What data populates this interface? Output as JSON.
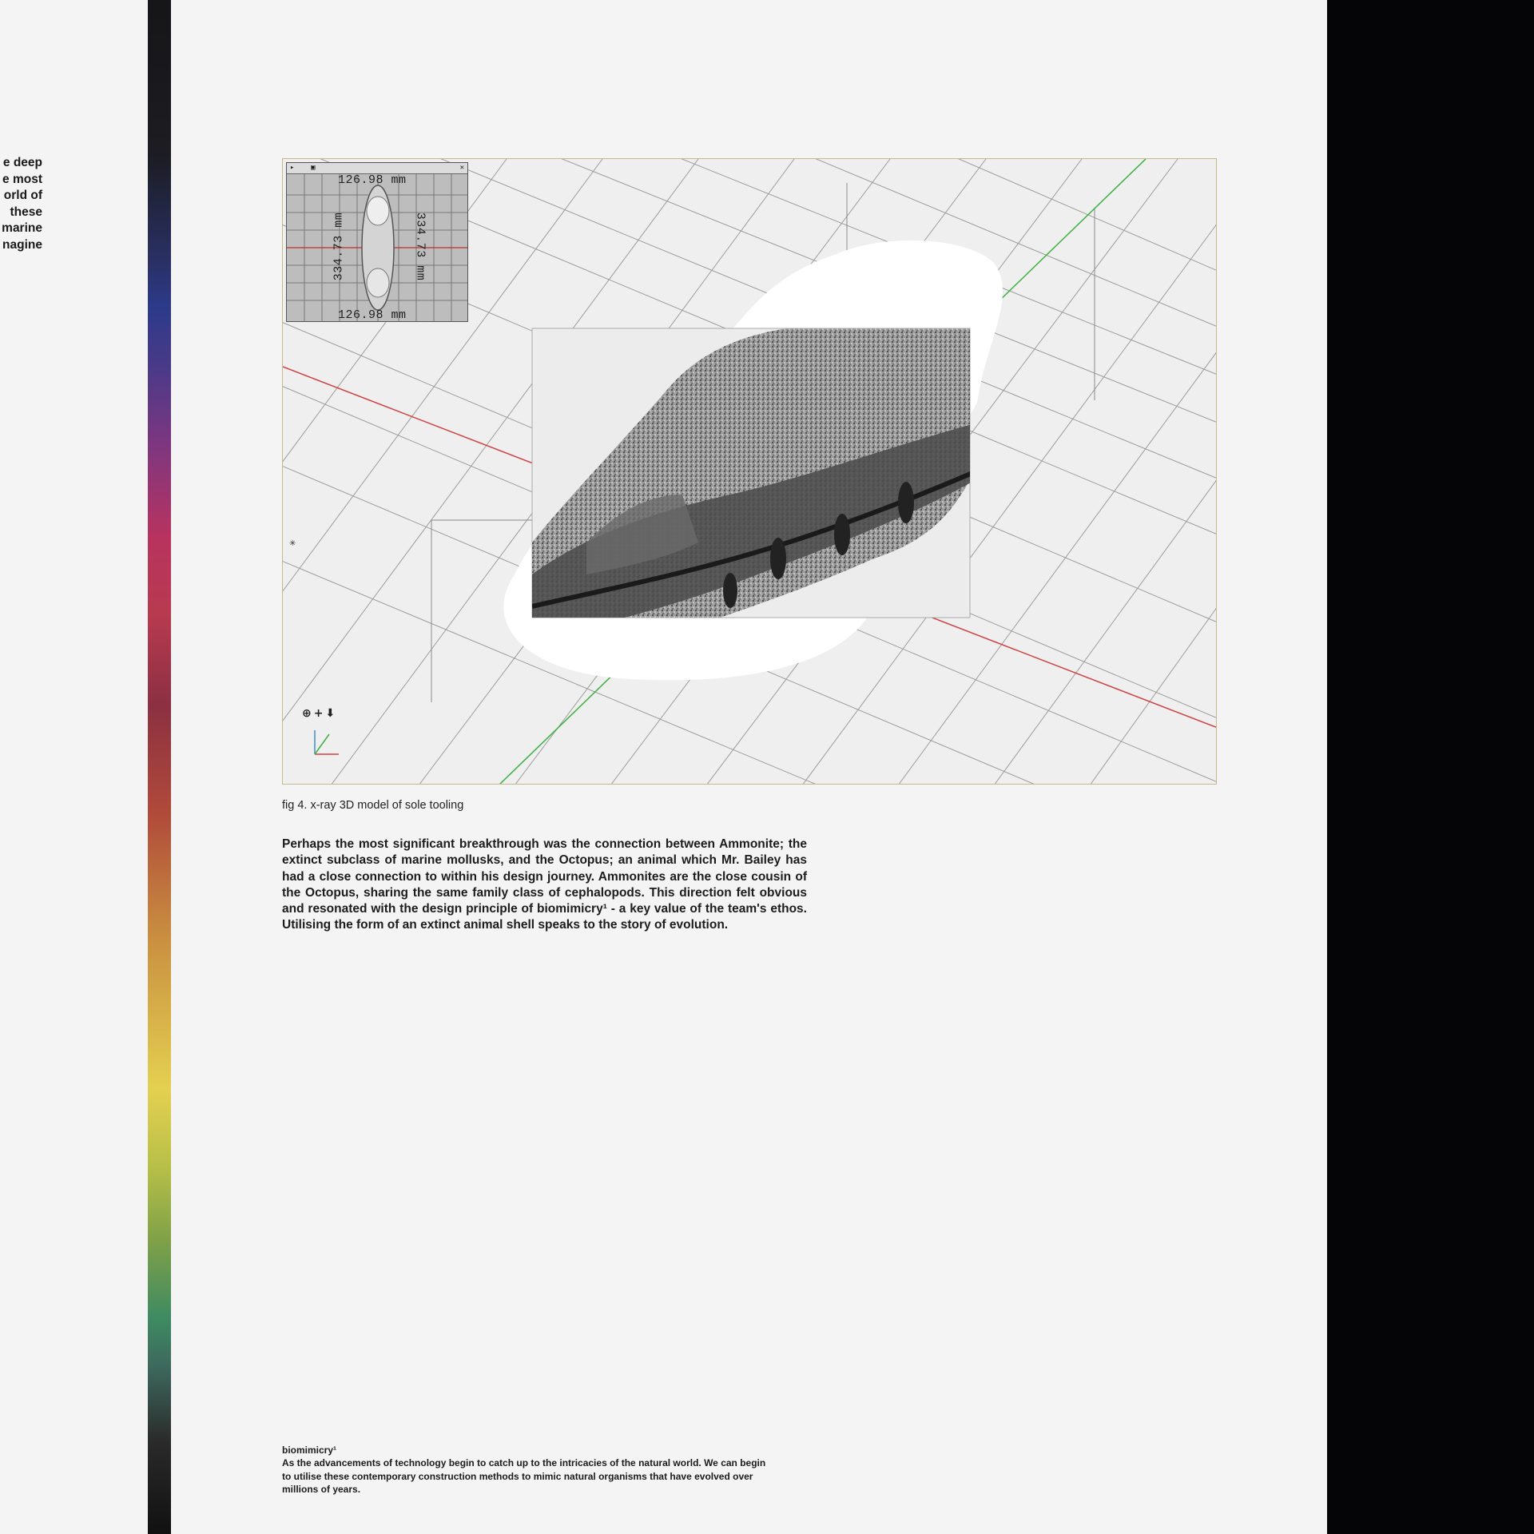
{
  "left_page": {
    "fragments": [
      "e deep",
      "e most",
      "orld of",
      "these",
      "marine",
      "nagine"
    ]
  },
  "figure": {
    "mini_view": {
      "dim_top": "126.98 mm",
      "dim_bottom": "126.98 mm",
      "dim_left": "334.73 mm",
      "dim_right": "334.73 mm"
    },
    "axis_controls": "⊕+⬇"
  },
  "caption": "fig 4. x-ray 3D model of sole tooling",
  "body": {
    "paragraph": "Perhaps the most significant breakthrough was the connection between Ammonite; the extinct subclass of marine mollusks, and the Octopus; an animal which Mr. Bailey has had a close connection to within his design journey. Ammonites are the close cousin of the Octopus, sharing the same family class of cephalopods. This direction felt obvious and resonated with the design principle of biomimicry¹ - a key value of the team's ethos. Utilising the form of an extinct animal shell speaks to the story of evolution."
  },
  "footnote": {
    "title": "biomimicry¹",
    "text": "As the advancements of technology begin to catch up to the intricacies of the natural world. We can begin to utilise these contemporary construction methods to mimic natural organisms that have evolved over millions of years."
  },
  "colors": {
    "page": "#f4f4f4",
    "right_panel": "#050507",
    "red_axis": "#d04040",
    "green_axis": "#3cb040"
  }
}
